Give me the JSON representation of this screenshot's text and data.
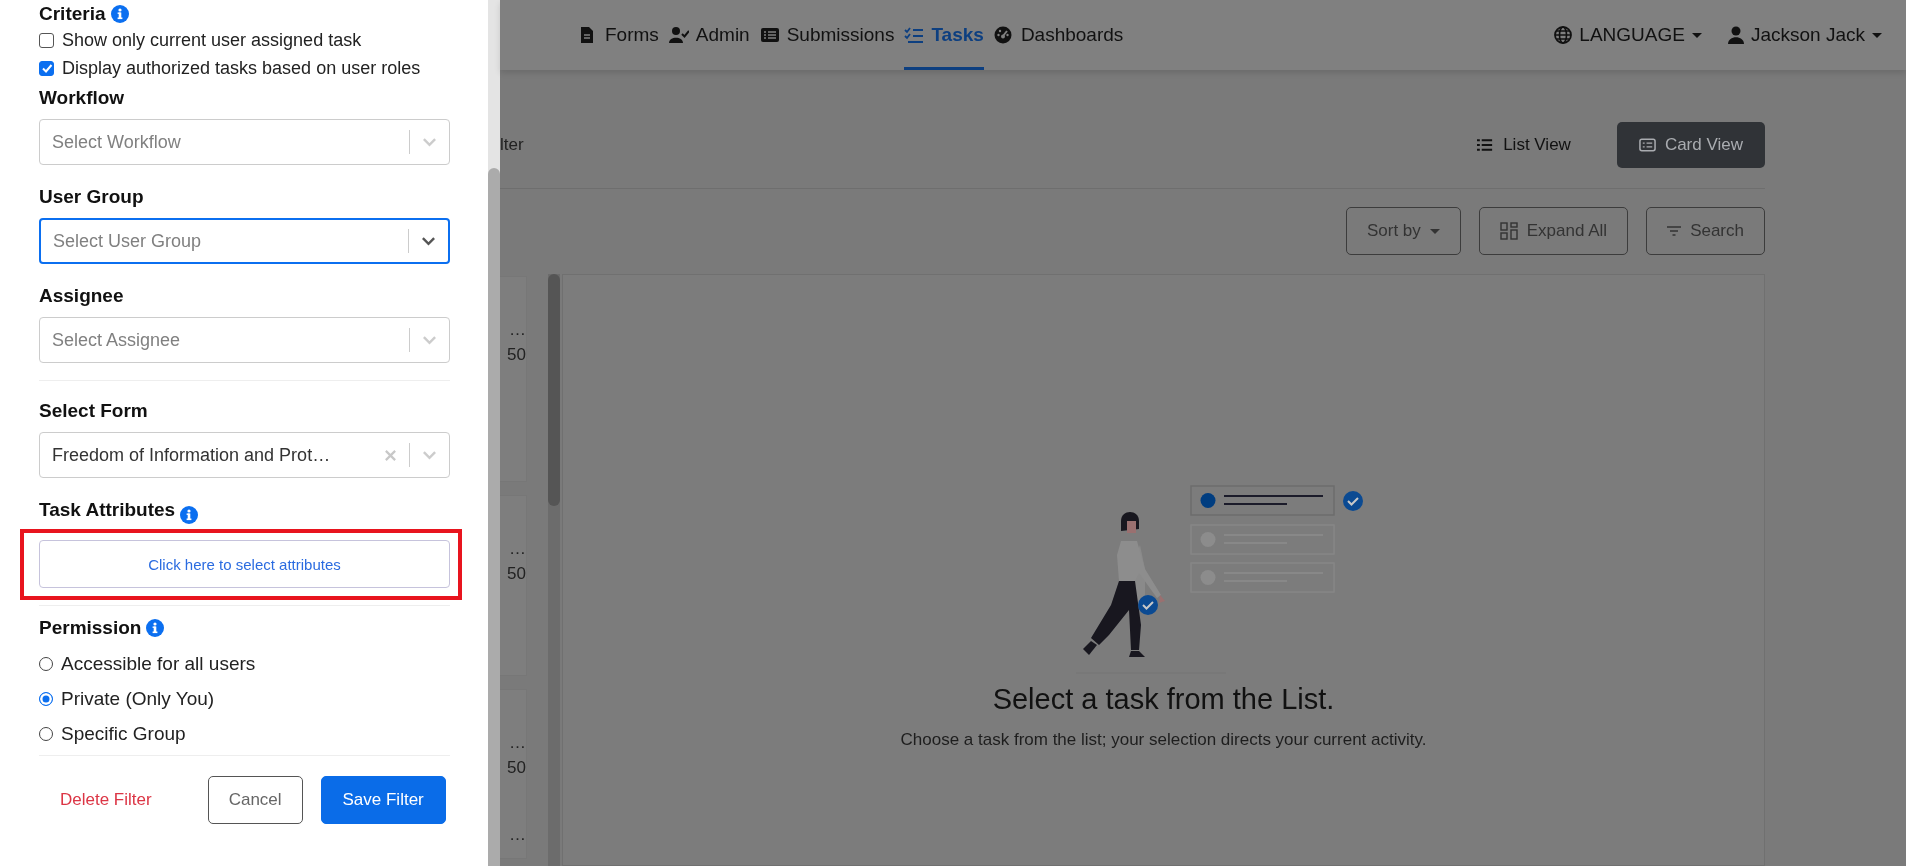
{
  "nav": {
    "links": [
      {
        "label": "Forms",
        "selected": false
      },
      {
        "label": "Admin",
        "selected": false
      },
      {
        "label": "Submissions",
        "selected": false
      },
      {
        "label": "Tasks",
        "selected": true
      },
      {
        "label": "Dashboards",
        "selected": false
      }
    ],
    "language": "LANGUAGE",
    "user": "Jackson Jack"
  },
  "filter_panel": {
    "criteria": {
      "title": "Criteria",
      "options": [
        {
          "label": "Show only current user assigned task",
          "checked": false
        },
        {
          "label": "Display authorized tasks based on user roles",
          "checked": true
        }
      ]
    },
    "selects": [
      {
        "label": "Workflow",
        "placeholder": "Select Workflow",
        "focused": false
      },
      {
        "label": "User Group",
        "placeholder": "Select User Group",
        "focused": true
      },
      {
        "label": "Assignee",
        "placeholder": "Select Assignee",
        "focused": false
      }
    ],
    "form_select": {
      "label": "Select Form",
      "value": "Freedom of Information and Prot…"
    },
    "task_attributes": {
      "label": "Task Attributes",
      "button": "Click here to select attributes",
      "highlighted": true
    },
    "permission": {
      "title": "Permission",
      "options": [
        {
          "label": "Accessible for all users",
          "selected": false
        },
        {
          "label": "Private (Only You)",
          "selected": true
        },
        {
          "label": "Specific Group",
          "selected": false
        }
      ]
    },
    "actions": {
      "delete": "Delete Filter",
      "cancel": "Cancel",
      "save": "Save Filter"
    }
  },
  "toolbar": {
    "partial_label": "lter",
    "views": [
      {
        "label": "List View",
        "selected": false
      },
      {
        "label": "Card View",
        "selected": true
      }
    ],
    "buttons": [
      "Sort by",
      "Expand All",
      "Search"
    ]
  },
  "task_cards": [
    {
      "lines": [
        "…",
        "50"
      ]
    },
    {
      "lines": [
        "…",
        "50"
      ]
    },
    {
      "lines": [
        "…",
        "50",
        "…"
      ]
    }
  ],
  "empty_state": {
    "title": "Select a task from the List.",
    "message": "Choose a task from the list; your selection directs your current activity."
  }
}
